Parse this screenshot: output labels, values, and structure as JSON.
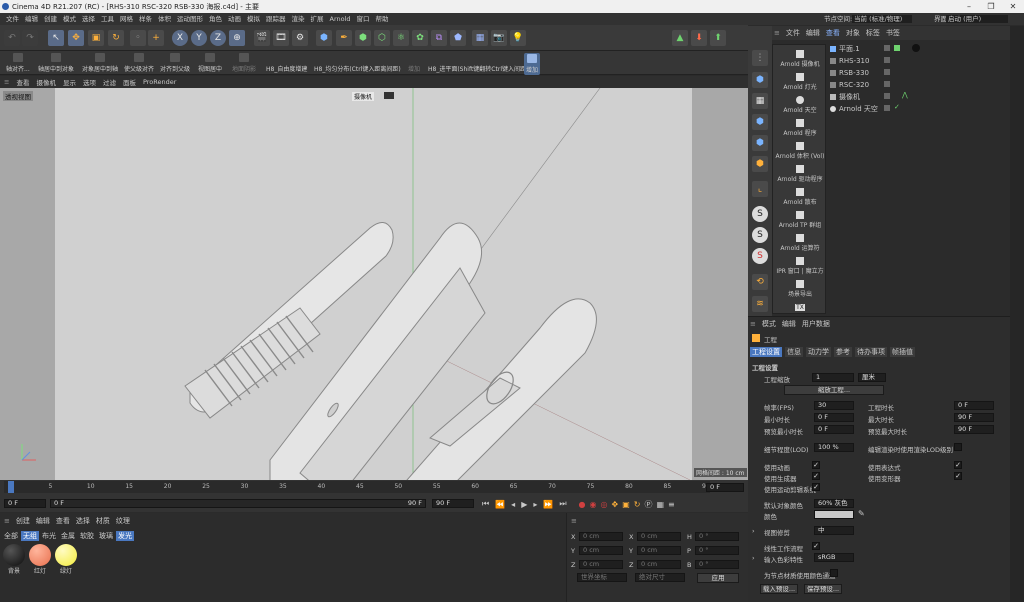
{
  "window": {
    "title": "Cinema 4D R21.207 (RC) - [RHS-310 RSC-320 RSB-330 海报.c4d] - 主要"
  },
  "menu": [
    "文件",
    "编辑",
    "创建",
    "模式",
    "选择",
    "工具",
    "网格",
    "样条",
    "体积",
    "运动图形",
    "角色",
    "动画",
    "模拟",
    "跟踪器",
    "渲染",
    "扩展",
    "Arnold",
    "窗口",
    "帮助"
  ],
  "layout": {
    "node_label": "节点空间:",
    "node_value": "当前 (标准/物理)",
    "ui_label": "界面:",
    "ui_value": "启动 (用户)"
  },
  "toolbar2": [
    "轴对齐...",
    "轴居中到对象",
    "对象居中到轴",
    "使父级对齐",
    "对齐到父级",
    "视图居中",
    "地面阴影",
    "H8_自由度增建",
    "H8_均匀分布(Ctrl键入距离间距)",
    "增加",
    "H8_进平面(Shift键翻转Ctrl键入间距)",
    "增加"
  ],
  "viewport": {
    "menu": [
      "查看",
      "摄像机",
      "显示",
      "选项",
      "过滤",
      "面板",
      "ProRender"
    ],
    "label": "透视视图",
    "camera": "摄像机",
    "grid": "网格间距 : 10 cm"
  },
  "timeline": {
    "ticks": [
      "0",
      "5",
      "10",
      "15",
      "20",
      "25",
      "30",
      "35",
      "40",
      "45",
      "50",
      "55",
      "60",
      "65",
      "70",
      "75",
      "80",
      "85",
      "90"
    ],
    "current": "0 F",
    "start": "0 F",
    "start2": "0 F",
    "end": "90 F",
    "end2": "90 F"
  },
  "material_panel": {
    "menu": [
      "创建",
      "编辑",
      "查看",
      "选择",
      "材质",
      "纹理"
    ],
    "filters": [
      "全部",
      "无组",
      "布光",
      "金属",
      "软胶",
      "玻璃",
      "发光"
    ],
    "materials": [
      {
        "name": "背景",
        "color": "#1a1a1a"
      },
      {
        "name": "红灯",
        "color": "#e8704e"
      },
      {
        "name": "绿灯",
        "color": "#f3ec3a"
      }
    ]
  },
  "coords": {
    "rows": [
      {
        "a": "X",
        "av": "0 cm",
        "b": "X",
        "bv": "0 cm",
        "c": "H",
        "cv": "0 °"
      },
      {
        "a": "Y",
        "av": "0 cm",
        "b": "Y",
        "bv": "0 cm",
        "c": "P",
        "cv": "0 °"
      },
      {
        "a": "Z",
        "av": "0 cm",
        "b": "Z",
        "bv": "0 cm",
        "c": "B",
        "cv": "0 °"
      }
    ],
    "world": "世界坐标",
    "scale": "绝对尺寸",
    "apply": "应用"
  },
  "obj_tabs": [
    "文件",
    "编辑",
    "查看",
    "对象",
    "标签",
    "书签"
  ],
  "objects": [
    {
      "name": "平面.1"
    },
    {
      "name": "RHS-310"
    },
    {
      "name": "RSB-330"
    },
    {
      "name": "RSC-320"
    },
    {
      "name": "摄像机"
    },
    {
      "name": "Arnold 天空"
    }
  ],
  "arnold_menu": [
    "Arnold 摄像机",
    "Arnold 灯光",
    "Arnold 天空",
    "Arnold 程序",
    "Arnold 体积 (Vol)",
    "Arnold 驱动程序",
    "Arnold 散布",
    "Arnold TP 群组",
    "Arnold 运算符",
    "IPR 窗口 | 魔立方",
    "场景导出",
    "TX"
  ],
  "attr": {
    "menu": [
      "模式",
      "编辑",
      "用户数据"
    ],
    "header": "工程",
    "tabs": [
      "工程设置",
      "信息",
      "动力学",
      "参考",
      "待办事项",
      "帧插值"
    ],
    "section": "工程设置",
    "scale_label": "工程缩放",
    "scale_value": "1",
    "scale_unit": "厘米",
    "scale_btn": "缩放工程...",
    "fps_label": "帧率(FPS)",
    "fps": "30",
    "len_label": "工程时长",
    "len": "0 F",
    "min_label": "最小时长",
    "min": "0 F",
    "max_label": "最大时长",
    "max": "90 F",
    "pmin_label": "预览最小时长",
    "pmin": "0 F",
    "pmax_label": "预览最大时长",
    "pmax": "90 F",
    "lod_label": "细节程度(LOD)",
    "lod": "100 %",
    "lod_chk": "编辑渲染时使用渲染LOD级别",
    "anim": "使用动画",
    "expr": "使用表达式",
    "gen": "使用生成器",
    "deform": "使用变形器",
    "motion": "使用运动剪辑系统",
    "color_label": "默认对象颜色",
    "color_value": "60% 灰色",
    "color2": "颜色",
    "clip_label": "视图修剪",
    "clip_value": "中",
    "linear": "线性工作流程",
    "profile_label": "输入色彩特性",
    "profile_value": "sRGB",
    "node_chk": "为节点材质使用颜色通道",
    "load_btn": "载入预设...",
    "save_btn": "保存预设..."
  }
}
